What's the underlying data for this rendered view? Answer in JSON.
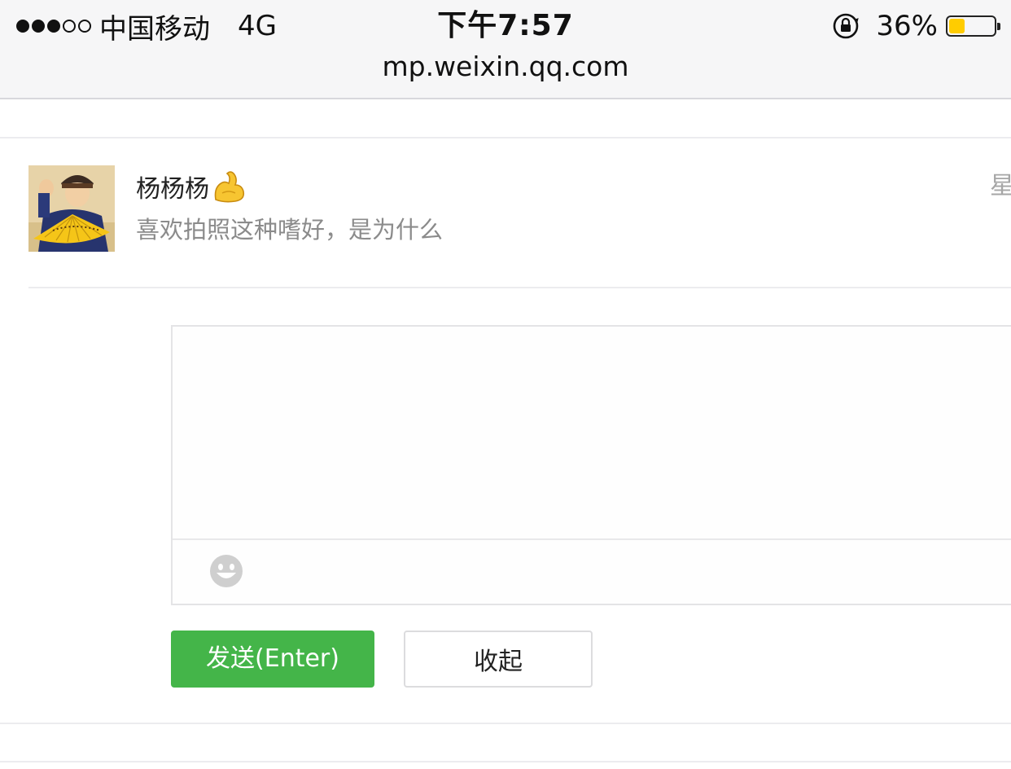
{
  "status_bar": {
    "signal_dots": "●●●○○",
    "carrier": "中国移动",
    "network": "4G",
    "time": "下午7:57",
    "battery_percent": "36%",
    "battery_level": 0.36,
    "battery_color": "#ffcc00",
    "url": "mp.weixin.qq.com"
  },
  "comment": {
    "username": "杨杨杨",
    "username_emoji": "muscle-icon",
    "message": "喜欢拍照这种嗜好，是为什么",
    "date_partial": "星"
  },
  "reply": {
    "textarea_value": "",
    "emoji_button_icon": "smiley-icon",
    "send_label": "发送(Enter)",
    "collapse_label": "收起",
    "send_color": "#44b549"
  }
}
